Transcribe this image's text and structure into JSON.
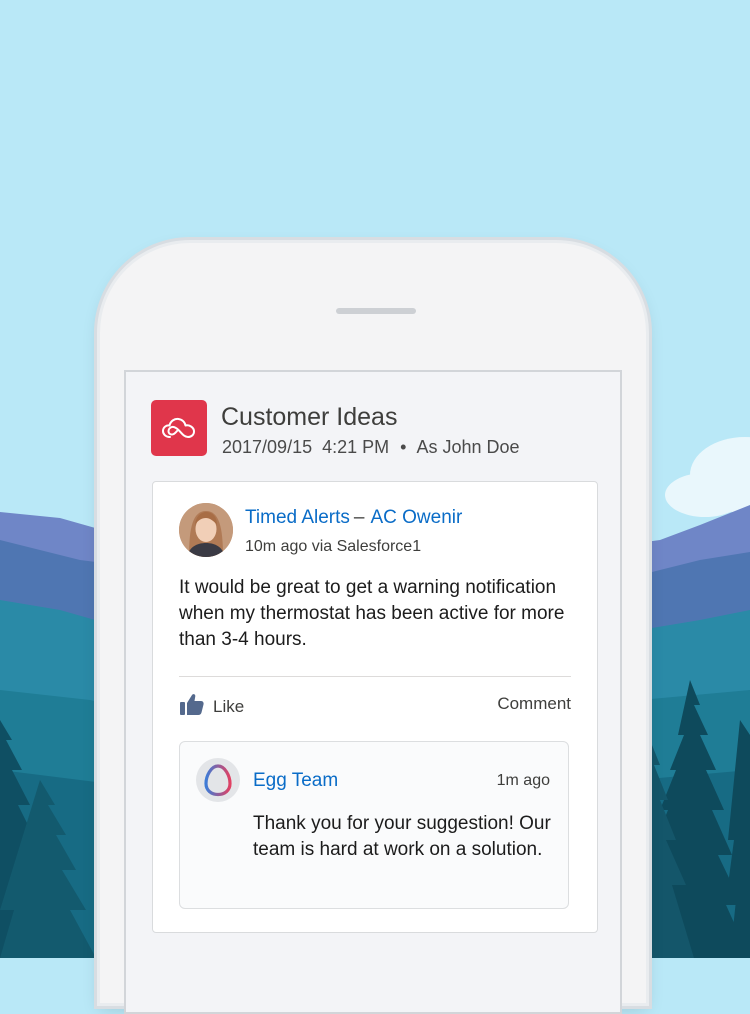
{
  "group": {
    "title": "Customer Ideas",
    "date": "2017/09/15",
    "time": "4:21 PM",
    "separator": "•",
    "as_user": "As John Doe",
    "icon": "cloud-logo-icon"
  },
  "post": {
    "topic": "Timed Alerts",
    "separator": "–",
    "author": "AC Owenir",
    "meta": "10m ago via Salesforce1",
    "body": "It would be great to get a warning notification when my thermostat has been active for more than 3-4 hours.",
    "like_label": "Like",
    "comment_label": "Comment"
  },
  "reply": {
    "author": "Egg Team",
    "time": "1m ago",
    "body": "Thank you for your suggestion! Our team is hard at work on a solution."
  },
  "colors": {
    "sky": "#b9e8f7",
    "brand_red": "#e0364b",
    "link_blue": "#0a6cc7"
  }
}
